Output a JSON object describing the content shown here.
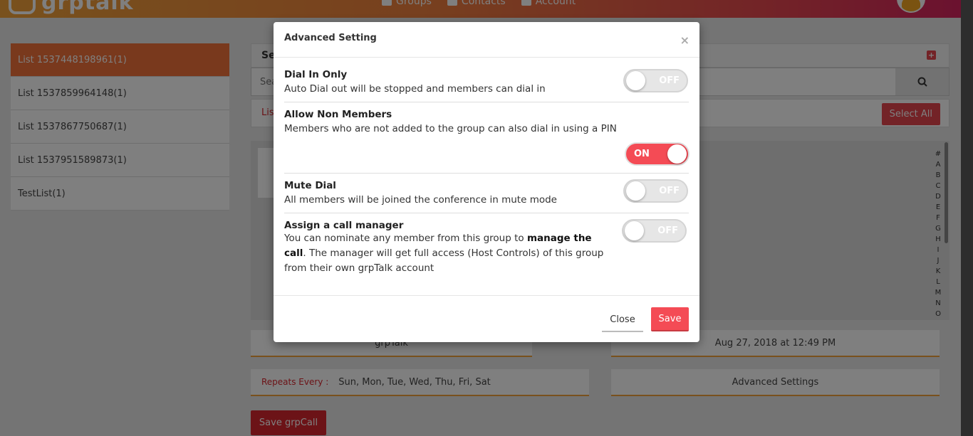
{
  "header": {
    "logo_text": "grptalk",
    "nav": [
      {
        "label": "Groups",
        "icon": "groups-icon"
      },
      {
        "label": "Contacts",
        "icon": "contacts-icon"
      },
      {
        "label": "Account",
        "icon": "account-icon"
      }
    ]
  },
  "sidebar": {
    "items": [
      {
        "label": "List 153744819896​1(1)",
        "active": true
      },
      {
        "label": "List 1537859964148(1)",
        "active": false
      },
      {
        "label": "List 1537867750687(1)",
        "active": false
      },
      {
        "label": "List 1537951589873(1)",
        "active": false
      },
      {
        "label": "TestList(1)",
        "active": false
      }
    ]
  },
  "main": {
    "panel_title_fragment": "Se",
    "search_placeholder": "Sea",
    "tab_fragment": "Lis",
    "select_all_label": "Select All",
    "alphabet": [
      "#",
      "A",
      "B",
      "C",
      "D",
      "E",
      "F",
      "G",
      "H",
      "I",
      "J",
      "K",
      "L",
      "M",
      "N",
      "O"
    ],
    "group_name": "grpTalk",
    "schedule": "Aug 27, 2018 at 12:49 PM",
    "repeats_label": "Repeats Every :",
    "repeats_days": "Sun, Mon, Tue, Wed, Thu, Fri, Sat",
    "advanced_settings_label": "Advanced Settings",
    "save_grpcall_label": "Save grpCall"
  },
  "modal": {
    "title": "Advanced Setting",
    "close_glyph": "×",
    "settings": [
      {
        "title": "Dial In Only",
        "description": "Auto Dial out will be stopped and members can dial in",
        "state": "OFF"
      },
      {
        "title": "Allow Non Members",
        "description": "Members who are not added to the group can also dial in using a PIN",
        "state": "ON"
      },
      {
        "title": "Mute Dial",
        "description": "All members will be joined the conference in mute mode",
        "state": "OFF"
      },
      {
        "title": "Assign a call manager",
        "description_part1": "You can nominate any member from this group to ",
        "description_bold": "manage the call",
        "description_part2": ". The manager will get full access (Host Controls) of this group from their own grpTalk account",
        "state": "OFF"
      }
    ],
    "close_button": "Close",
    "save_button": "Save"
  },
  "colors": {
    "accent_red": "#f44b55",
    "active_list": "#f2733a",
    "header_gradient_start": "#f2a33a",
    "header_gradient_end": "#d6245f"
  }
}
